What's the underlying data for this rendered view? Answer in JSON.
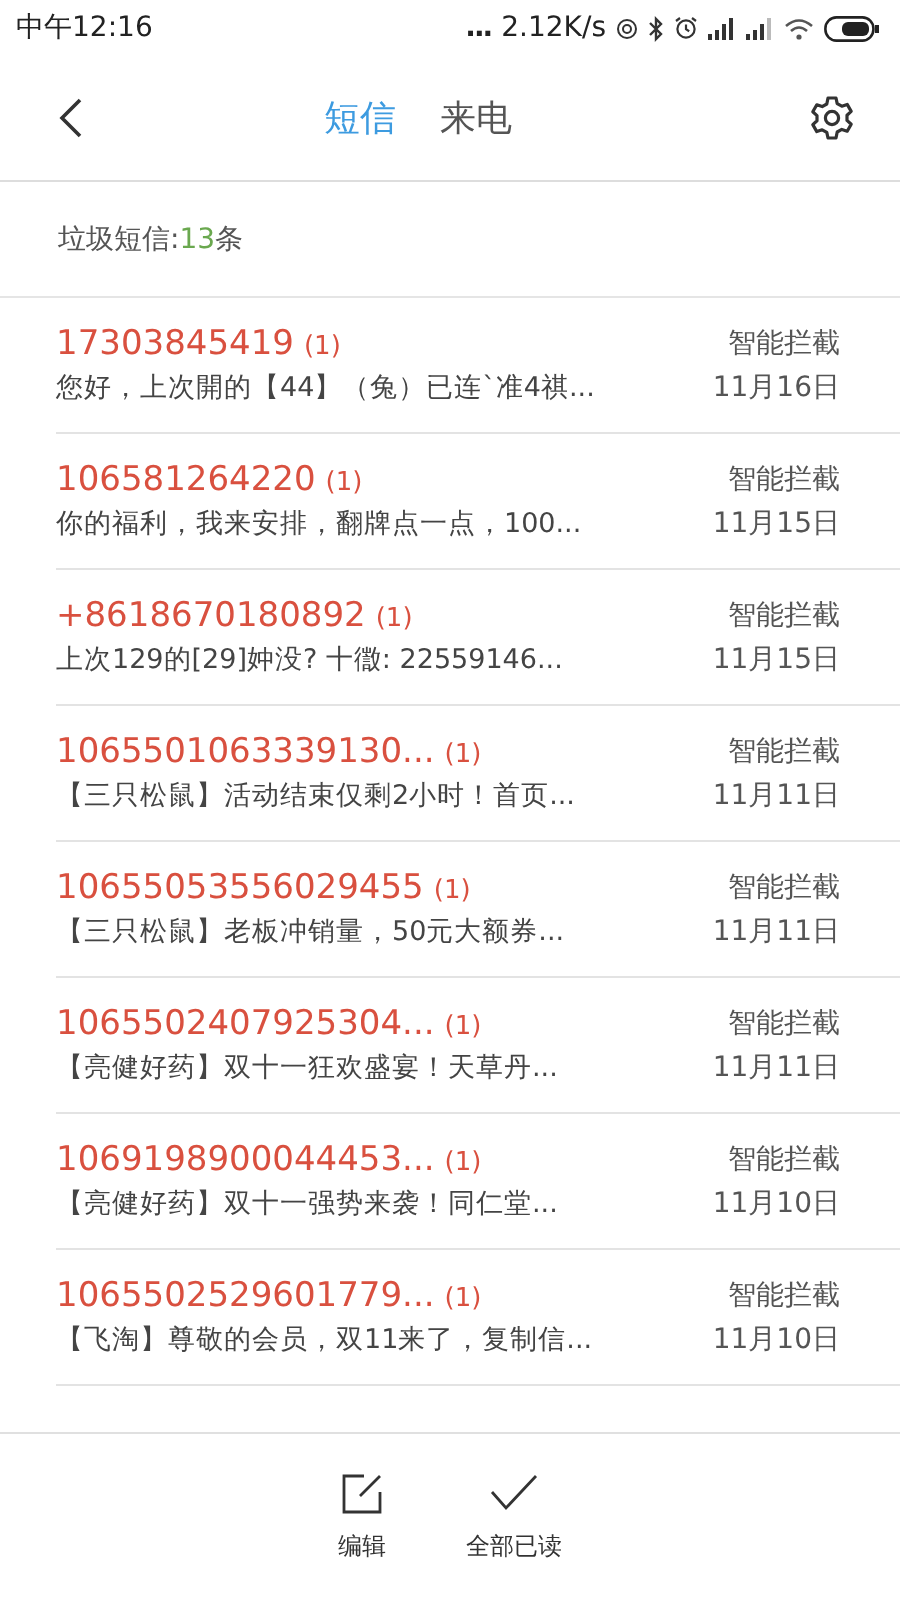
{
  "status_bar": {
    "time": "中午12:16",
    "dots": "...",
    "speed": "2.12K/s"
  },
  "header": {
    "tabs": [
      {
        "label": "短信",
        "selected": true
      },
      {
        "label": "来电",
        "selected": false
      }
    ]
  },
  "summary": {
    "label": "垃圾短信:",
    "count": "13",
    "unit": "条"
  },
  "messages": [
    {
      "sender": "17303845419",
      "count": "(1)",
      "preview": "您好，上次開的【44】（兔）已连`准4祺...",
      "tag": "智能拦截",
      "date": "11月16日"
    },
    {
      "sender": "106581264220",
      "count": "(1)",
      "preview": "你的福利，我来安排，翻牌点一点，100...",
      "tag": "智能拦截",
      "date": "11月15日"
    },
    {
      "sender": "+8618670180892",
      "count": "(1)",
      "preview": "上次129的[29]妕没? 十徾: 22559146...",
      "tag": "智能拦截",
      "date": "11月15日"
    },
    {
      "sender": "1065501063339130...",
      "count": "(1)",
      "preview": "【三只松鼠】活动结束仅剩2小时！首页...",
      "tag": "智能拦截",
      "date": "11月11日"
    },
    {
      "sender": "10655053556029455",
      "count": "(1)",
      "preview": "【三只松鼠】老板冲销量，50元大额券...",
      "tag": "智能拦截",
      "date": "11月11日"
    },
    {
      "sender": "1065502407925304...",
      "count": "(1)",
      "preview": "【亮健好药】双十一狂欢盛宴！天草丹...",
      "tag": "智能拦截",
      "date": "11月11日"
    },
    {
      "sender": "1069198900044453...",
      "count": "(1)",
      "preview": "【亮健好药】双十一强势来袭！同仁堂...",
      "tag": "智能拦截",
      "date": "11月10日"
    },
    {
      "sender": "1065502529601779...",
      "count": "(1)",
      "preview": "【飞淘】尊敬的会员，双11来了，复制信...",
      "tag": "智能拦截",
      "date": "11月10日"
    }
  ],
  "toolbar": [
    {
      "kind": "edit",
      "label": "编辑"
    },
    {
      "kind": "check",
      "label": "全部已读"
    }
  ]
}
